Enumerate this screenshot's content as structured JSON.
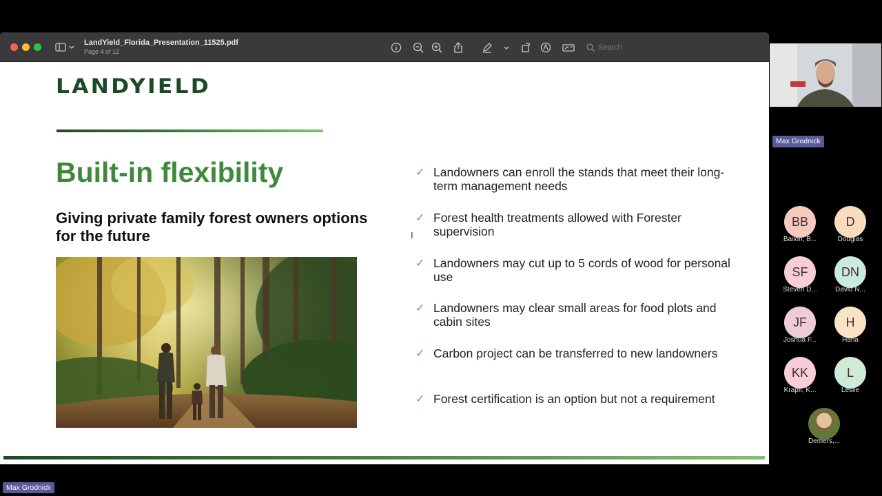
{
  "viewer": {
    "doc_title": "LandYield_Florida_Presentation_11525.pdf",
    "page_indicator": "Page 4 of 12",
    "search_placeholder": "Search"
  },
  "slide": {
    "logo": "LANDYIELD",
    "heading": "Built-in flexibility",
    "subheading": "Giving private family forest owners options for the future",
    "bullets": [
      "Landowners can enroll the stands that meet their long-term management needs",
      "Forest health treatments allowed with Forester supervision",
      "Landowners may cut up to 5 cords of wood for personal use",
      "Landowners may clear small areas for food plots and cabin sites",
      "Carbon project can be transferred to new landowners",
      "Forest certification is an option but not a requirement"
    ],
    "check_glyph": "✓"
  },
  "meeting": {
    "active_speaker": "Max Grodnick",
    "presenter_label": "Max Grodnick",
    "participants": [
      {
        "initials": "BB",
        "name": "Bailon, B...",
        "color": "#f6c9c0"
      },
      {
        "initials": "D",
        "name": "Douglas",
        "color": "#f9dcbf"
      },
      {
        "initials": "SF",
        "name": "Steven D...",
        "color": "#f6cfd6"
      },
      {
        "initials": "DN",
        "name": "David N...",
        "color": "#c8eadf"
      },
      {
        "initials": "JF",
        "name": "Joshua F...",
        "color": "#eecbd8"
      },
      {
        "initials": "H",
        "name": "Hana",
        "color": "#fbe3c6"
      },
      {
        "initials": "KK",
        "name": "Krapfl, K...",
        "color": "#f7cdd8"
      },
      {
        "initials": "L",
        "name": "Leslie",
        "color": "#cfead6"
      },
      {
        "initials": "",
        "name": "Demers,...",
        "color": "#c9b48a"
      }
    ]
  }
}
